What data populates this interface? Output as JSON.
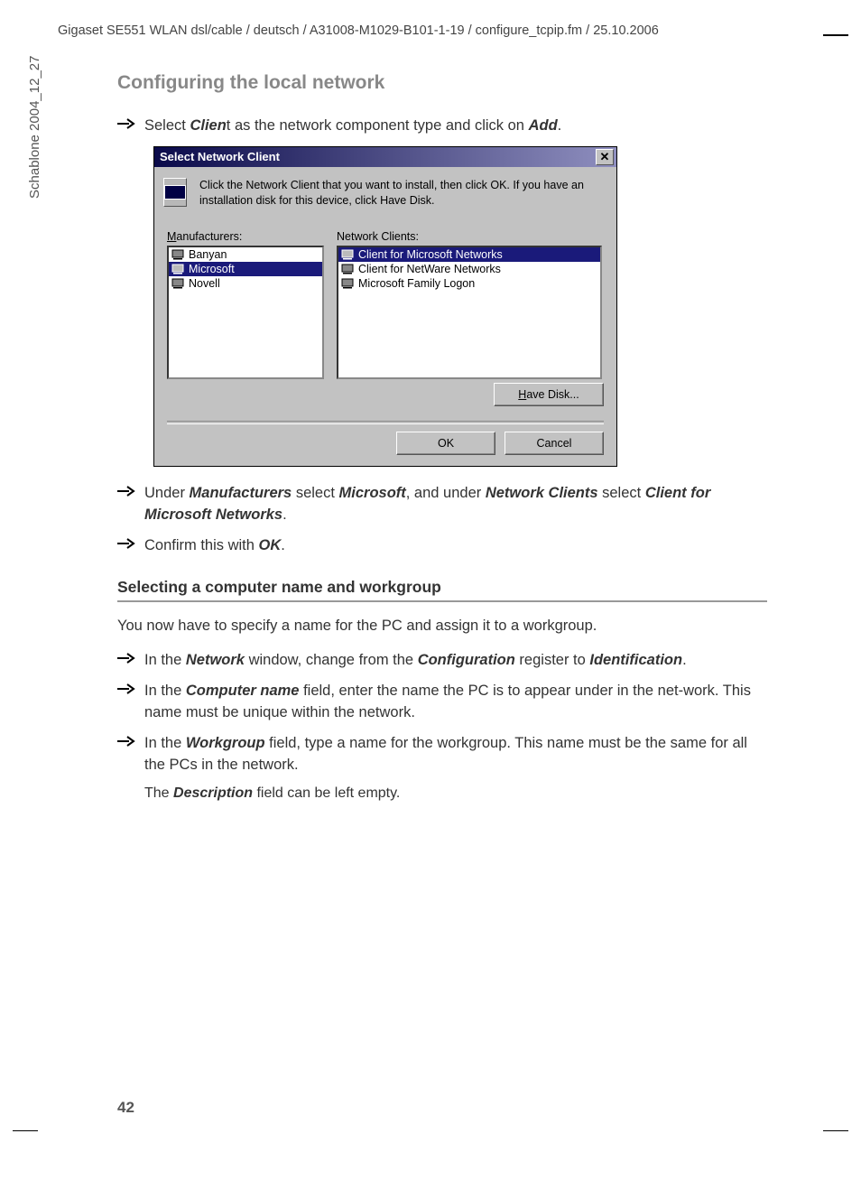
{
  "header": "Gigaset SE551 WLAN dsl/cable / deutsch / A31008-M1029-B101-1-19 / configure_tcpip.fm / 25.10.2006",
  "sideText": "Schablone 2004_12_27",
  "title": "Configuring the local network",
  "pageNumber": "42",
  "step1": {
    "pre": "Select ",
    "b1": "Clien",
    "mid": "t as the network component type and click on ",
    "b2": "Add",
    "post": "."
  },
  "dialog": {
    "title": "Select Network Client",
    "instruction": "Click the Network Client that you want to install, then click OK. If you have an installation disk for this device, click Have Disk.",
    "manuLabelU": "M",
    "manuLabelRest": "anufacturers:",
    "clientsLabel": "Network Clients:",
    "manufacturers": [
      "Banyan",
      "Microsoft",
      "Novell"
    ],
    "manuSelectedIndex": 1,
    "clients": [
      "Client for Microsoft Networks",
      "Client for NetWare Networks",
      "Microsoft Family Logon"
    ],
    "clientSelectedIndex": 0,
    "haveDiskU": "H",
    "haveDiskRest": "ave Disk...",
    "ok": "OK",
    "cancel": "Cancel"
  },
  "step2": {
    "pre": "Under ",
    "b1": "Manufacturers",
    "mid1": " select ",
    "b2": "Microsoft",
    "mid2": ", and under ",
    "b3": "Network Clients",
    "mid3": " select ",
    "b4": "Client for Microsoft Networks",
    "post": "."
  },
  "step3": {
    "pre": "Confirm this with ",
    "b1": "OK",
    "post": "."
  },
  "subhead": "Selecting a computer name and workgroup",
  "para1": "You now have to specify a name for the PC and assign it to a workgroup.",
  "step4": {
    "pre": "In the ",
    "b1": "Network",
    "mid1": " window, change from the ",
    "b2": "Configuration",
    "mid2": " register to ",
    "b3": "Identification",
    "post": "."
  },
  "step5": {
    "pre": "In the ",
    "b1": "Computer name",
    "post": " field, enter the name the PC is to appear under in the net-work. This name must be unique within the network."
  },
  "step6": {
    "pre": "In the ",
    "b1": "Workgroup",
    "post": " field, type a name for the workgroup. This name must be the same for all the PCs in the network."
  },
  "descLine": {
    "pre": "The ",
    "b1": "Description",
    "post": " field can be left empty."
  }
}
